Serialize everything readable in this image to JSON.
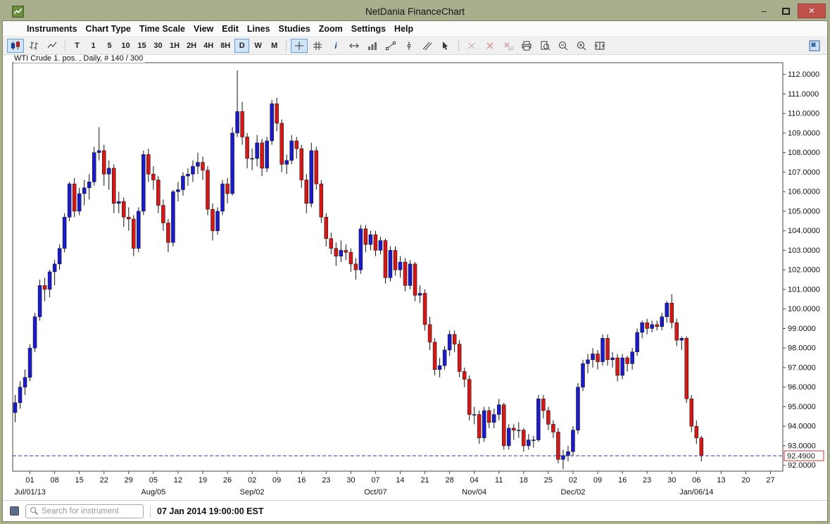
{
  "window": {
    "title": "NetDania FinanceChart",
    "controls": {
      "minimize_label": "–",
      "close_label": "×"
    }
  },
  "menu": {
    "items": [
      "Instruments",
      "Chart Type",
      "Time Scale",
      "View",
      "Edit",
      "Lines",
      "Studies",
      "Zoom",
      "Settings",
      "Help"
    ]
  },
  "toolbar": {
    "buttons": [
      {
        "name": "chart-type-candlestick-button",
        "icon": "candlestick-icon",
        "selected": true
      },
      {
        "name": "chart-type-bars-button",
        "icon": "ohlc-bars-icon"
      },
      {
        "name": "chart-type-line-button",
        "icon": "line-chart-icon"
      },
      {
        "type": "sep"
      },
      {
        "name": "timescale-tick-button",
        "label": "T"
      },
      {
        "name": "timescale-1min-button",
        "label": "1"
      },
      {
        "name": "timescale-5min-button",
        "label": "5"
      },
      {
        "name": "timescale-10min-button",
        "label": "10"
      },
      {
        "name": "timescale-15min-button",
        "label": "15"
      },
      {
        "name": "timescale-30min-button",
        "label": "30"
      },
      {
        "name": "timescale-1h-button",
        "label": "1H"
      },
      {
        "name": "timescale-2h-button",
        "label": "2H"
      },
      {
        "name": "timescale-4h-button",
        "label": "4H"
      },
      {
        "name": "timescale-8h-button",
        "label": "8H"
      },
      {
        "name": "timescale-daily-button",
        "label": "D",
        "selected": true
      },
      {
        "name": "timescale-weekly-button",
        "label": "W"
      },
      {
        "name": "timescale-monthly-button",
        "label": "M"
      },
      {
        "type": "sep"
      },
      {
        "name": "crosshair-button",
        "icon": "crosshair-icon",
        "selected": true
      },
      {
        "name": "grid-button",
        "icon": "grid-icon"
      },
      {
        "name": "info-button",
        "icon": "info-icon"
      },
      {
        "name": "scale-horizontal-button",
        "icon": "h-expand-icon"
      },
      {
        "name": "volume-button",
        "icon": "volume-icon"
      },
      {
        "name": "trendline-button",
        "icon": "trendline-icon"
      },
      {
        "name": "vertical-line-button",
        "icon": "vline-icon"
      },
      {
        "name": "channel-button",
        "icon": "channel-icon"
      },
      {
        "name": "pointer-button",
        "icon": "pointer-icon"
      },
      {
        "type": "sep"
      },
      {
        "name": "remove-line-button",
        "icon": "remove-line-icon",
        "disabled": true
      },
      {
        "name": "delete-selected-button",
        "icon": "delete-x-icon",
        "disabled": true
      },
      {
        "name": "delete-all-button",
        "icon": "delete-all-icon",
        "disabled": true
      },
      {
        "name": "print-button",
        "icon": "print-icon"
      },
      {
        "name": "print-preview-button",
        "icon": "preview-icon"
      },
      {
        "name": "zoom-out-button",
        "icon": "zoom-out-icon"
      },
      {
        "name": "zoom-in-button",
        "icon": "zoom-in-icon"
      },
      {
        "name": "zoom-fit-button",
        "icon": "zoom-fit-icon"
      },
      {
        "type": "spacer"
      },
      {
        "name": "sidebar-toggle-button",
        "icon": "panel-icon"
      }
    ]
  },
  "chart": {
    "header": "WTI Crude 1. pos. , Daily, # 140 / 300"
  },
  "statusbar": {
    "search_placeholder": "Search for instrument",
    "datetime": "07 Jan 2014 19:00:00 EST"
  },
  "chart_data": {
    "type": "candlestick",
    "title": "WTI Crude 1. pos. , Daily, # 140 / 300",
    "instrument": "WTI Crude 1. pos.",
    "timeframe": "Daily",
    "bars_visible": 140,
    "bars_loaded": 300,
    "ylim": [
      91.7,
      112.6
    ],
    "y_axis": {
      "start": 112,
      "end": 92,
      "step": 1,
      "decimals": 4
    },
    "slots": 156,
    "first_tick_index": 3,
    "tick_every": 5,
    "x_ticks": [
      "01",
      "08",
      "15",
      "22",
      "29",
      "05",
      "12",
      "19",
      "26",
      "02",
      "09",
      "16",
      "23",
      "30",
      "07",
      "14",
      "21",
      "28",
      "04",
      "11",
      "18",
      "25",
      "02",
      "09",
      "16",
      "23",
      "30",
      "06",
      "13",
      "20",
      "27"
    ],
    "x_month_labels": [
      {
        "tick": 0,
        "label": "Jul/01/13"
      },
      {
        "tick": 5,
        "label": "Aug/05"
      },
      {
        "tick": 9,
        "label": "Sep/02"
      },
      {
        "tick": 14,
        "label": "Oct/07"
      },
      {
        "tick": 18,
        "label": "Nov/04"
      },
      {
        "tick": 22,
        "label": "Dec/02"
      },
      {
        "tick": 27,
        "label": "Jan/06/14"
      }
    ],
    "up_color": "#1b1bc8",
    "down_color": "#d41717",
    "last_price": {
      "value": 92.49,
      "label": "92.4900",
      "line_color": "#2233aa",
      "box_color": "#cc3333"
    },
    "ohlc": [
      [
        94.7,
        95.6,
        94.2,
        95.2
      ],
      [
        95.2,
        96.3,
        94.9,
        96.0
      ],
      [
        96.0,
        96.9,
        95.6,
        96.5
      ],
      [
        96.5,
        98.2,
        96.3,
        98.0
      ],
      [
        98.0,
        99.8,
        97.8,
        99.6
      ],
      [
        99.6,
        101.5,
        99.4,
        101.2
      ],
      [
        101.2,
        101.6,
        100.4,
        101.0
      ],
      [
        101.0,
        102.0,
        100.6,
        101.9
      ],
      [
        101.9,
        102.5,
        101.2,
        102.3
      ],
      [
        102.3,
        103.3,
        102.0,
        103.1
      ],
      [
        103.1,
        104.9,
        102.9,
        104.7
      ],
      [
        104.7,
        106.5,
        104.5,
        106.4
      ],
      [
        106.4,
        106.7,
        104.7,
        105.0
      ],
      [
        105.0,
        106.2,
        104.8,
        105.9
      ],
      [
        105.9,
        106.6,
        105.3,
        106.2
      ],
      [
        106.2,
        106.9,
        105.6,
        106.5
      ],
      [
        106.5,
        108.3,
        106.3,
        108.0
      ],
      [
        108.0,
        109.3,
        107.6,
        108.1
      ],
      [
        108.1,
        108.4,
        106.3,
        106.9
      ],
      [
        106.9,
        107.6,
        106.1,
        107.2
      ],
      [
        107.2,
        107.4,
        104.9,
        105.4
      ],
      [
        105.4,
        106.0,
        104.9,
        105.5
      ],
      [
        105.5,
        105.7,
        104.2,
        104.7
      ],
      [
        104.7,
        105.2,
        104.0,
        104.6
      ],
      [
        104.6,
        104.8,
        102.7,
        103.1
      ],
      [
        103.1,
        105.2,
        102.9,
        105.0
      ],
      [
        105.0,
        108.1,
        104.8,
        107.9
      ],
      [
        107.9,
        108.2,
        106.5,
        106.9
      ],
      [
        106.9,
        107.3,
        106.1,
        106.6
      ],
      [
        106.6,
        106.8,
        104.9,
        105.3
      ],
      [
        105.3,
        105.6,
        104.0,
        104.4
      ],
      [
        104.4,
        104.6,
        102.9,
        103.4
      ],
      [
        103.4,
        106.1,
        103.2,
        106.0
      ],
      [
        106.0,
        106.5,
        105.5,
        106.1
      ],
      [
        106.1,
        107.0,
        105.8,
        106.8
      ],
      [
        106.8,
        107.2,
        106.3,
        106.9
      ],
      [
        106.9,
        107.6,
        106.5,
        107.3
      ],
      [
        107.3,
        108.0,
        106.9,
        107.5
      ],
      [
        107.5,
        107.8,
        106.6,
        107.1
      ],
      [
        107.1,
        107.3,
        104.8,
        105.1
      ],
      [
        105.1,
        105.4,
        103.5,
        104.0
      ],
      [
        104.0,
        105.2,
        103.8,
        105.0
      ],
      [
        105.0,
        106.6,
        104.8,
        106.4
      ],
      [
        106.4,
        106.7,
        105.4,
        105.9
      ],
      [
        105.9,
        109.3,
        105.8,
        109.0
      ],
      [
        109.0,
        112.2,
        108.8,
        110.1
      ],
      [
        110.1,
        110.6,
        108.4,
        108.8
      ],
      [
        108.8,
        109.0,
        107.2,
        107.7
      ],
      [
        107.7,
        108.2,
        107.1,
        107.7
      ],
      [
        107.7,
        108.9,
        107.3,
        108.5
      ],
      [
        108.5,
        108.7,
        106.8,
        107.2
      ],
      [
        107.2,
        108.8,
        107.0,
        108.6
      ],
      [
        108.6,
        110.7,
        108.4,
        110.5
      ],
      [
        110.5,
        110.8,
        109.1,
        109.5
      ],
      [
        109.5,
        109.7,
        107.0,
        107.4
      ],
      [
        107.4,
        107.9,
        106.9,
        107.6
      ],
      [
        107.6,
        108.9,
        107.4,
        108.6
      ],
      [
        108.6,
        108.8,
        107.7,
        108.2
      ],
      [
        108.2,
        108.4,
        106.2,
        106.6
      ],
      [
        106.6,
        106.9,
        104.9,
        105.4
      ],
      [
        105.4,
        108.5,
        105.2,
        108.1
      ],
      [
        108.1,
        108.3,
        106.1,
        106.4
      ],
      [
        106.4,
        106.6,
        104.4,
        104.7
      ],
      [
        104.7,
        104.9,
        103.2,
        103.6
      ],
      [
        103.6,
        103.9,
        102.8,
        103.1
      ],
      [
        103.1,
        103.4,
        102.2,
        102.7
      ],
      [
        102.7,
        103.5,
        102.4,
        103.0
      ],
      [
        103.0,
        103.3,
        102.5,
        102.9
      ],
      [
        102.9,
        103.1,
        101.9,
        102.3
      ],
      [
        102.3,
        102.6,
        101.5,
        102.0
      ],
      [
        102.0,
        104.3,
        101.8,
        104.1
      ],
      [
        104.1,
        104.3,
        102.9,
        103.3
      ],
      [
        103.3,
        104.0,
        103.0,
        103.8
      ],
      [
        103.8,
        104.0,
        102.7,
        103.0
      ],
      [
        103.0,
        103.7,
        102.8,
        103.5
      ],
      [
        103.5,
        103.6,
        101.3,
        101.6
      ],
      [
        101.6,
        103.2,
        101.4,
        103.0
      ],
      [
        103.0,
        103.2,
        101.7,
        102.0
      ],
      [
        102.0,
        102.7,
        101.6,
        102.4
      ],
      [
        102.4,
        102.6,
        100.9,
        101.2
      ],
      [
        101.2,
        102.5,
        101.0,
        102.3
      ],
      [
        102.3,
        102.4,
        100.4,
        100.7
      ],
      [
        100.7,
        101.2,
        100.3,
        100.8
      ],
      [
        100.8,
        101.0,
        98.9,
        99.2
      ],
      [
        99.2,
        99.6,
        97.9,
        98.3
      ],
      [
        98.3,
        98.5,
        96.6,
        96.9
      ],
      [
        96.9,
        97.5,
        96.5,
        97.1
      ],
      [
        97.1,
        98.1,
        96.9,
        97.9
      ],
      [
        97.9,
        98.9,
        97.6,
        98.7
      ],
      [
        98.7,
        98.9,
        97.8,
        98.2
      ],
      [
        98.2,
        98.4,
        96.5,
        96.8
      ],
      [
        96.8,
        97.0,
        96.0,
        96.4
      ],
      [
        96.4,
        96.6,
        94.3,
        94.6
      ],
      [
        94.6,
        95.0,
        94.1,
        94.6
      ],
      [
        94.6,
        94.8,
        93.1,
        93.4
      ],
      [
        93.4,
        95.0,
        93.2,
        94.8
      ],
      [
        94.8,
        95.0,
        93.9,
        94.2
      ],
      [
        94.2,
        94.9,
        93.9,
        94.6
      ],
      [
        94.6,
        95.4,
        94.3,
        95.1
      ],
      [
        95.1,
        95.2,
        92.8,
        93.0
      ],
      [
        93.0,
        94.1,
        92.8,
        93.9
      ],
      [
        93.9,
        94.1,
        93.3,
        93.8
      ],
      [
        93.8,
        94.2,
        93.4,
        93.8
      ],
      [
        93.8,
        93.9,
        92.7,
        93.0
      ],
      [
        93.0,
        93.6,
        92.8,
        93.3
      ],
      [
        93.3,
        93.5,
        92.9,
        93.3
      ],
      [
        93.3,
        95.6,
        93.2,
        95.4
      ],
      [
        95.4,
        95.6,
        94.4,
        94.8
      ],
      [
        94.8,
        95.0,
        93.8,
        94.1
      ],
      [
        94.1,
        94.3,
        93.4,
        93.7
      ],
      [
        93.7,
        93.9,
        92.1,
        92.3
      ],
      [
        92.3,
        92.8,
        91.8,
        92.5
      ],
      [
        92.5,
        93.0,
        92.2,
        92.7
      ],
      [
        92.7,
        94.0,
        92.5,
        93.8
      ],
      [
        93.8,
        96.2,
        93.6,
        96.0
      ],
      [
        96.0,
        97.4,
        95.8,
        97.2
      ],
      [
        97.2,
        97.7,
        96.7,
        97.4
      ],
      [
        97.4,
        98.0,
        97.0,
        97.7
      ],
      [
        97.7,
        97.9,
        96.9,
        97.3
      ],
      [
        97.3,
        98.7,
        97.1,
        98.5
      ],
      [
        98.5,
        98.7,
        97.1,
        97.4
      ],
      [
        97.4,
        97.8,
        97.0,
        97.5
      ],
      [
        97.5,
        97.7,
        96.3,
        96.6
      ],
      [
        96.6,
        97.7,
        96.4,
        97.5
      ],
      [
        97.5,
        97.6,
        96.8,
        97.2
      ],
      [
        97.2,
        98.0,
        96.9,
        97.8
      ],
      [
        97.8,
        99.0,
        97.6,
        98.8
      ],
      [
        98.8,
        99.4,
        98.5,
        99.3
      ],
      [
        99.3,
        99.5,
        98.7,
        99.0
      ],
      [
        99.0,
        99.4,
        98.8,
        99.2
      ],
      [
        99.2,
        99.4,
        98.9,
        99.1
      ],
      [
        99.1,
        99.8,
        98.9,
        99.6
      ],
      [
        99.6,
        100.4,
        99.3,
        100.3
      ],
      [
        100.3,
        100.75,
        99.0,
        99.3
      ],
      [
        99.3,
        99.5,
        98.1,
        98.4
      ],
      [
        98.4,
        98.6,
        97.9,
        98.5
      ],
      [
        98.5,
        98.6,
        95.2,
        95.4
      ],
      [
        95.4,
        95.6,
        93.7,
        94.0
      ],
      [
        94.0,
        94.3,
        93.1,
        93.4
      ],
      [
        93.4,
        93.5,
        92.2,
        92.49
      ]
    ]
  }
}
